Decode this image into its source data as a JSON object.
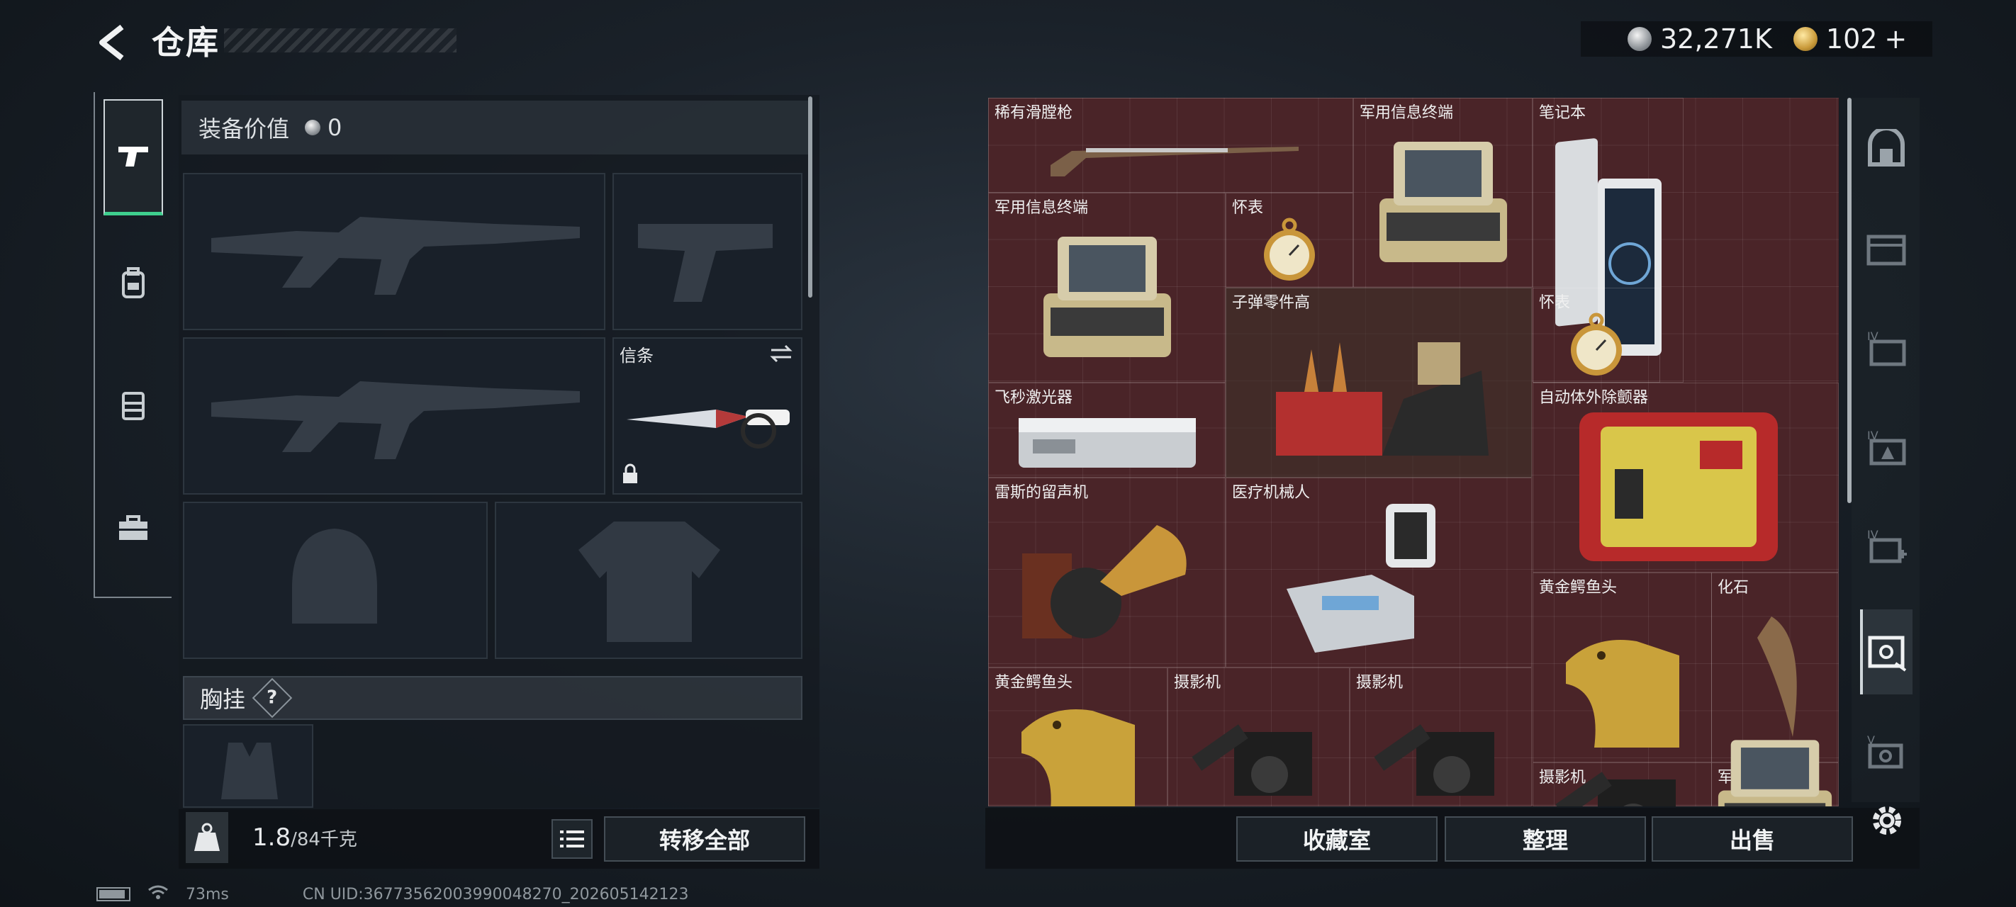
{
  "header": {
    "title": "仓库",
    "currency_silver": "32,271K",
    "currency_gold": "102",
    "add_symbol": "+"
  },
  "equipment": {
    "value_label": "装备价值",
    "value_amount": "0",
    "melee_label": "信条",
    "chest_rig_label": "胸挂",
    "help_label": "?"
  },
  "weight": {
    "current": "1.8",
    "max": "/84千克"
  },
  "buttons": {
    "transfer_all": "转移全部",
    "collection": "收藏室",
    "organize": "整理",
    "sell": "出售"
  },
  "stash_items": [
    {
      "label": "稀有滑膛枪",
      "art": "musket"
    },
    {
      "label": "军用信息终端",
      "art": "terminal"
    },
    {
      "label": "笔记本",
      "art": "laptop"
    },
    {
      "label": "军用信息终端",
      "art": "terminal"
    },
    {
      "label": "怀表",
      "art": "watch"
    },
    {
      "label": "子弹零件高",
      "art": "parts"
    },
    {
      "label": "怀表",
      "art": "watch"
    },
    {
      "label": "飞秒激光器",
      "art": "laser"
    },
    {
      "label": "自动体外除颤器",
      "art": "aed"
    },
    {
      "label": "雷斯的留声机",
      "art": "gramophone"
    },
    {
      "label": "医疗机械人",
      "art": "robot"
    },
    {
      "label": "黄金鳄鱼头",
      "art": "croc"
    },
    {
      "label": "化石",
      "art": "fossil"
    },
    {
      "label": "黄金鳄鱼头",
      "art": "croc"
    },
    {
      "label": "摄影机",
      "art": "camera"
    },
    {
      "label": "摄影机",
      "art": "camera"
    },
    {
      "label": "摄影机",
      "art": "camera"
    },
    {
      "label": "军用终端",
      "art": "terminal"
    }
  ],
  "status": {
    "ping": "73ms",
    "uid": "CN UID:367735620039900482​70_202605142123"
  },
  "colors": {
    "active_tab_accent": "#3ecf8e",
    "stash_background": "#4a2428"
  }
}
